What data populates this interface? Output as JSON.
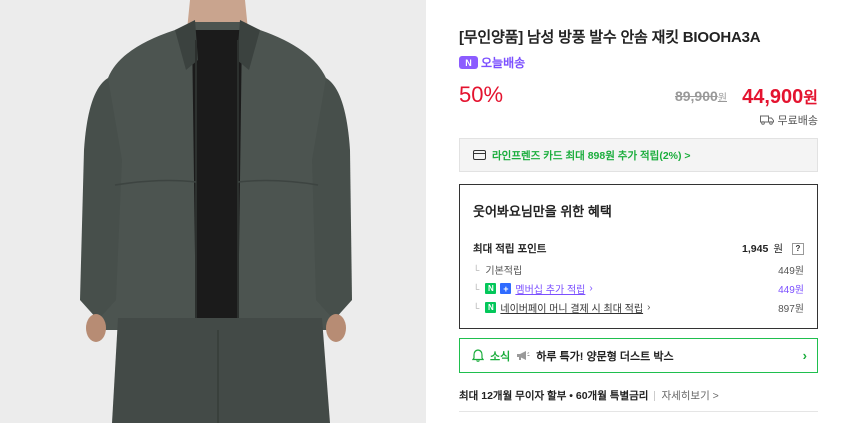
{
  "product": {
    "title": "[무인양품] 남성 방풍 발수 안솜 재킷 BIOOHA3A",
    "delivery_badge": "오늘배송",
    "discount": "50%",
    "original_price": "89,900",
    "original_unit": "원",
    "sale_price": "44,900",
    "sale_unit": "원",
    "shipping": "무료배송"
  },
  "card_promo": "라인프렌즈 카드 최대 898원 추가 적립(2%) >",
  "benefits": {
    "title": "웃어봐요님만을 위한 혜택",
    "max_points_label": "최대 적립 포인트",
    "max_points_value": "1,945",
    "max_points_unit": "원",
    "help": "?",
    "basic_label": "기본적립",
    "basic_value": "449원",
    "membership_label": "멤버십 추가 적립",
    "membership_value": "449원",
    "npay_label": "네이버페이 머니 결제 시 최대 적립",
    "npay_value": "897원"
  },
  "notice": {
    "label": "소식",
    "text": "하루 특가! 양문형 더스트 박스"
  },
  "installment": {
    "text": "최대 12개월 무이자 할부 • 60개월 특별금리",
    "more": "자세히보기 >"
  },
  "colors": {
    "price_red": "#e4132f",
    "naver_green": "#1aad3c",
    "purple": "#7b4fff"
  }
}
